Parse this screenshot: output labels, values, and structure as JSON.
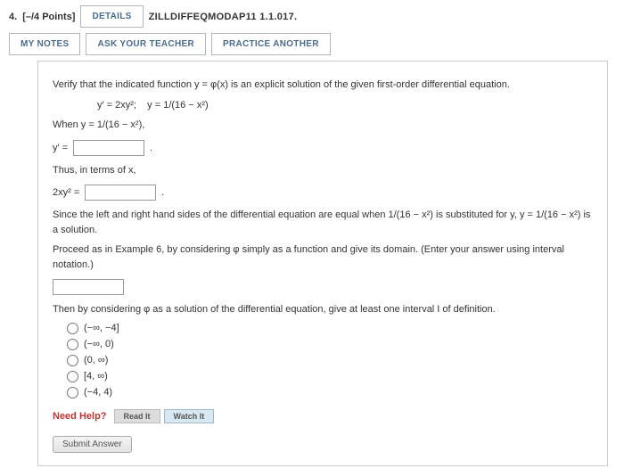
{
  "header": {
    "number": "4.",
    "points": "[–/4 Points]",
    "details": "DETAILS",
    "ref": "ZILLDIFFEQMODAP11 1.1.017.",
    "mynotes": "MY NOTES",
    "ask": "ASK YOUR TEACHER",
    "practice": "PRACTICE ANOTHER"
  },
  "body": {
    "verify": "Verify that the indicated function y = φ(x) is an explicit solution of the given first-order differential equation.",
    "eq_lhs": "y′ = 2xy²;",
    "eq_rhs": "y = 1/(16 − x²)",
    "when": "When y = 1/(16 − x²),",
    "yprime": "y′ =",
    "thus": "Thus, in terms of x,",
    "twoxy2": "2xy² =",
    "since_a": "Since the left and right hand sides of the differential equation are equal when 1/(16 − x²) is substituted for y, y = 1/(16 − x²) is a solution.",
    "proceed": "Proceed as in Example 6, by considering φ simply as a function and give its domain. (Enter your answer using interval notation.)",
    "thenby": "Then by considering φ as a solution of the differential equation, give at least one interval I of definition.",
    "period": "."
  },
  "options": [
    "(−∞, −4]",
    "(−∞, 0)",
    "(0, ∞)",
    "[4, ∞)",
    "(−4, 4)"
  ],
  "help": {
    "label": "Need Help?",
    "read": "Read It",
    "watch": "Watch It"
  },
  "submit": "Submit Answer"
}
